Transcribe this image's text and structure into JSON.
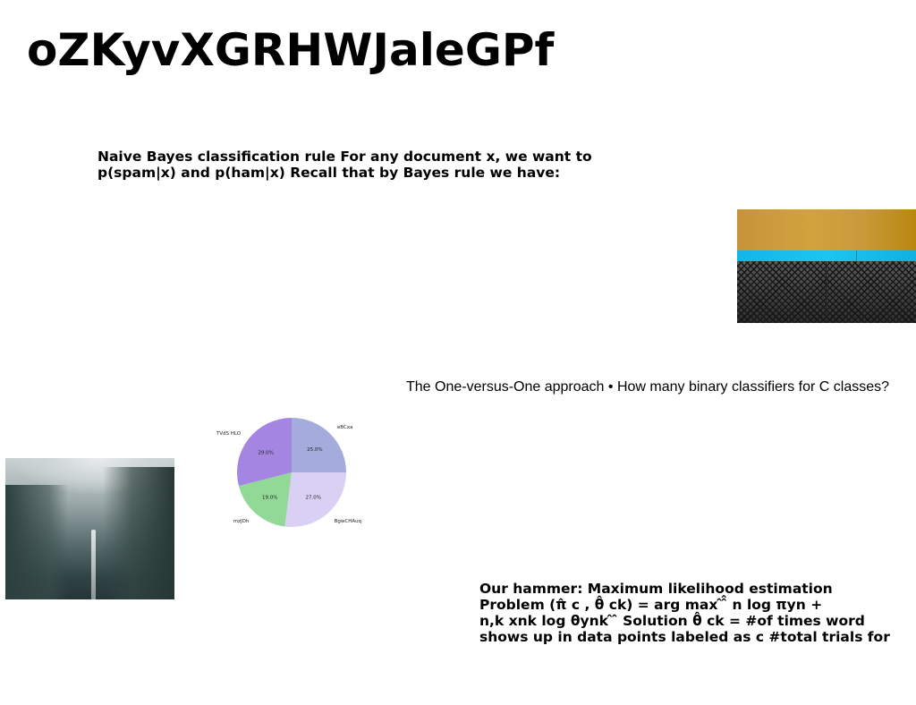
{
  "slide": {
    "title": "oZKyvXGRHWJaleGPf",
    "bayes_lines": [
      "Naive Bayes classification rule For any document x, we want to",
      "p(spam|x) and p(ham|x) Recall that by Bayes rule we have:"
    ],
    "ovo_text": "The One-versus-One approach • How many binary classifiers for C classes?",
    "hammer_lines": [
      "Our hammer: Maximum likelihood estimation",
      "Problem (π̂ c , θ̂ ck) = arg max ̂ ̂̂ n log πyn +",
      "n,k xnk log θynk ̂ ̂ Solution θ̂ ck = #of times word",
      "shows up in data points labeled as c #total trials for"
    ]
  },
  "images": {
    "mesh_photo": "gold-cyan-mesh-photo",
    "fog_photo": "foggy-waterfall-photo"
  },
  "chart_data": {
    "type": "pie",
    "title": "",
    "labels": [
      "eBCxa",
      "BgwCHAuq",
      "mzJDh",
      "TVdS HLO"
    ],
    "values": [
      25.0,
      27.0,
      19.0,
      29.0
    ],
    "value_labels": [
      "25.0%",
      "27.0%",
      "19.0%",
      "29.0%"
    ],
    "colors": [
      "#a4acdb",
      "#d9d0f3",
      "#92d896",
      "#a486e2"
    ],
    "start_angle": "top",
    "direction": "clockwise"
  }
}
